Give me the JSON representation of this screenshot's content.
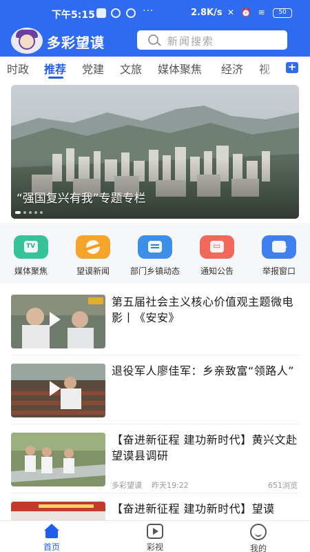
{
  "status_bar": {
    "time": "下午5:15",
    "dots": "···",
    "speed": "2.8K/s",
    "icons": "✕ ⏰ ≋",
    "battery": "50"
  },
  "header": {
    "app_title": "多彩望谟",
    "search_placeholder": "新闻搜索",
    "brand_color": "#2f6bf0"
  },
  "tabs": {
    "items": [
      "时政",
      "推荐",
      "党建",
      "文旅",
      "媒体聚焦",
      "经济",
      "视"
    ],
    "active": "推荐",
    "add_label": "+"
  },
  "banner": {
    "caption": "“强国复兴有我”专题专栏",
    "slide_count": 5,
    "active_slide": 1
  },
  "quick_links": [
    {
      "label": "媒体聚焦",
      "icon": "tv-icon",
      "color": "#36c39a"
    },
    {
      "label": "望谟新闻",
      "icon": "planet-icon",
      "color": "#f7a42b"
    },
    {
      "label": "部门乡镇动态",
      "icon": "document-icon",
      "color": "#3b8fe8"
    },
    {
      "label": "通知公告",
      "icon": "message-icon",
      "color": "#f2685a"
    },
    {
      "label": "举报窗口",
      "icon": "camera-icon",
      "color": "#3f7ff0"
    }
  ],
  "news": [
    {
      "title": "第五届社会主义核心价值观主题微电影丨《安安》",
      "has_video": true,
      "source": "",
      "time": "",
      "views": ""
    },
    {
      "title": "退役军人廖佳军：乡亲致富“领路人”",
      "has_video": true,
      "source": "",
      "time": "",
      "views": ""
    },
    {
      "title": "【奋进新征程 建功新时代】黄兴文赴望谟县调研",
      "has_video": false,
      "source": "多彩望谟",
      "time": "昨天19:22",
      "views": "651浏览"
    },
    {
      "title": "【奋进新征程 建功新时代】望谟",
      "has_video": false,
      "source": "",
      "time": "",
      "views": ""
    }
  ],
  "bottom_nav": [
    {
      "label": "首页",
      "icon": "home-icon",
      "active": true
    },
    {
      "label": "彩视",
      "icon": "video-icon",
      "active": false
    },
    {
      "label": "我的",
      "icon": "profile-icon",
      "active": false
    }
  ]
}
